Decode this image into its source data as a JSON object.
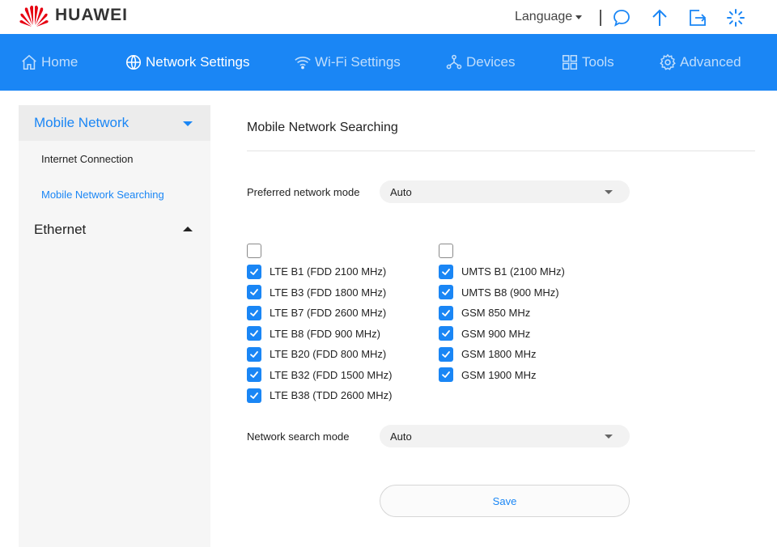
{
  "brand": {
    "name": "HUAWEI",
    "color": "#e60012"
  },
  "header": {
    "language_label": "Language",
    "icons": [
      "message-icon",
      "upload-icon",
      "logout-icon",
      "loading-spinner-icon"
    ]
  },
  "nav": {
    "items": [
      {
        "label": "Home",
        "icon": "home-icon",
        "active": false
      },
      {
        "label": "Network Settings",
        "icon": "globe-icon",
        "active": true
      },
      {
        "label": "Wi-Fi Settings",
        "icon": "wifi-icon",
        "active": false
      },
      {
        "label": "Devices",
        "icon": "devices-icon",
        "active": false
      },
      {
        "label": "Tools",
        "icon": "tools-icon",
        "active": false
      },
      {
        "label": "Advanced",
        "icon": "gear-icon",
        "active": false
      }
    ]
  },
  "sidebar": {
    "groups": [
      {
        "label": "Mobile Network",
        "expanded": true,
        "items": [
          "Internet Connection",
          "Mobile Network Searching"
        ],
        "active_item": "Mobile Network Searching"
      },
      {
        "label": "Ethernet",
        "expanded": false
      }
    ]
  },
  "main": {
    "title": "Mobile Network Searching",
    "preferred_mode": {
      "label": "Preferred network mode",
      "value": "Auto"
    },
    "lte_all_checked": false,
    "lte_bands": [
      {
        "label": "LTE B1 (FDD 2100 MHz)",
        "checked": true
      },
      {
        "label": "LTE B3 (FDD 1800 MHz)",
        "checked": true
      },
      {
        "label": "LTE B7 (FDD 2600 MHz)",
        "checked": true
      },
      {
        "label": "LTE B8 (FDD 900 MHz)",
        "checked": true
      },
      {
        "label": "LTE B20 (FDD 800 MHz)",
        "checked": true
      },
      {
        "label": "LTE B32 (FDD 1500 MHz)",
        "checked": true
      },
      {
        "label": "LTE B38 (TDD 2600 MHz)",
        "checked": true
      }
    ],
    "other_all_checked": false,
    "other_bands": [
      {
        "label": "UMTS B1 (2100 MHz)",
        "checked": true
      },
      {
        "label": "UMTS B8 (900 MHz)",
        "checked": true
      },
      {
        "label": "GSM 850 MHz",
        "checked": true
      },
      {
        "label": "GSM 900 MHz",
        "checked": true
      },
      {
        "label": "GSM 1800 MHz",
        "checked": true
      },
      {
        "label": "GSM 1900 MHz",
        "checked": true
      }
    ],
    "search_mode": {
      "label": "Network search mode",
      "value": "Auto"
    },
    "save_label": "Save"
  },
  "colors": {
    "accent": "#1a86f5",
    "nav_bg": "#1a86f5"
  }
}
